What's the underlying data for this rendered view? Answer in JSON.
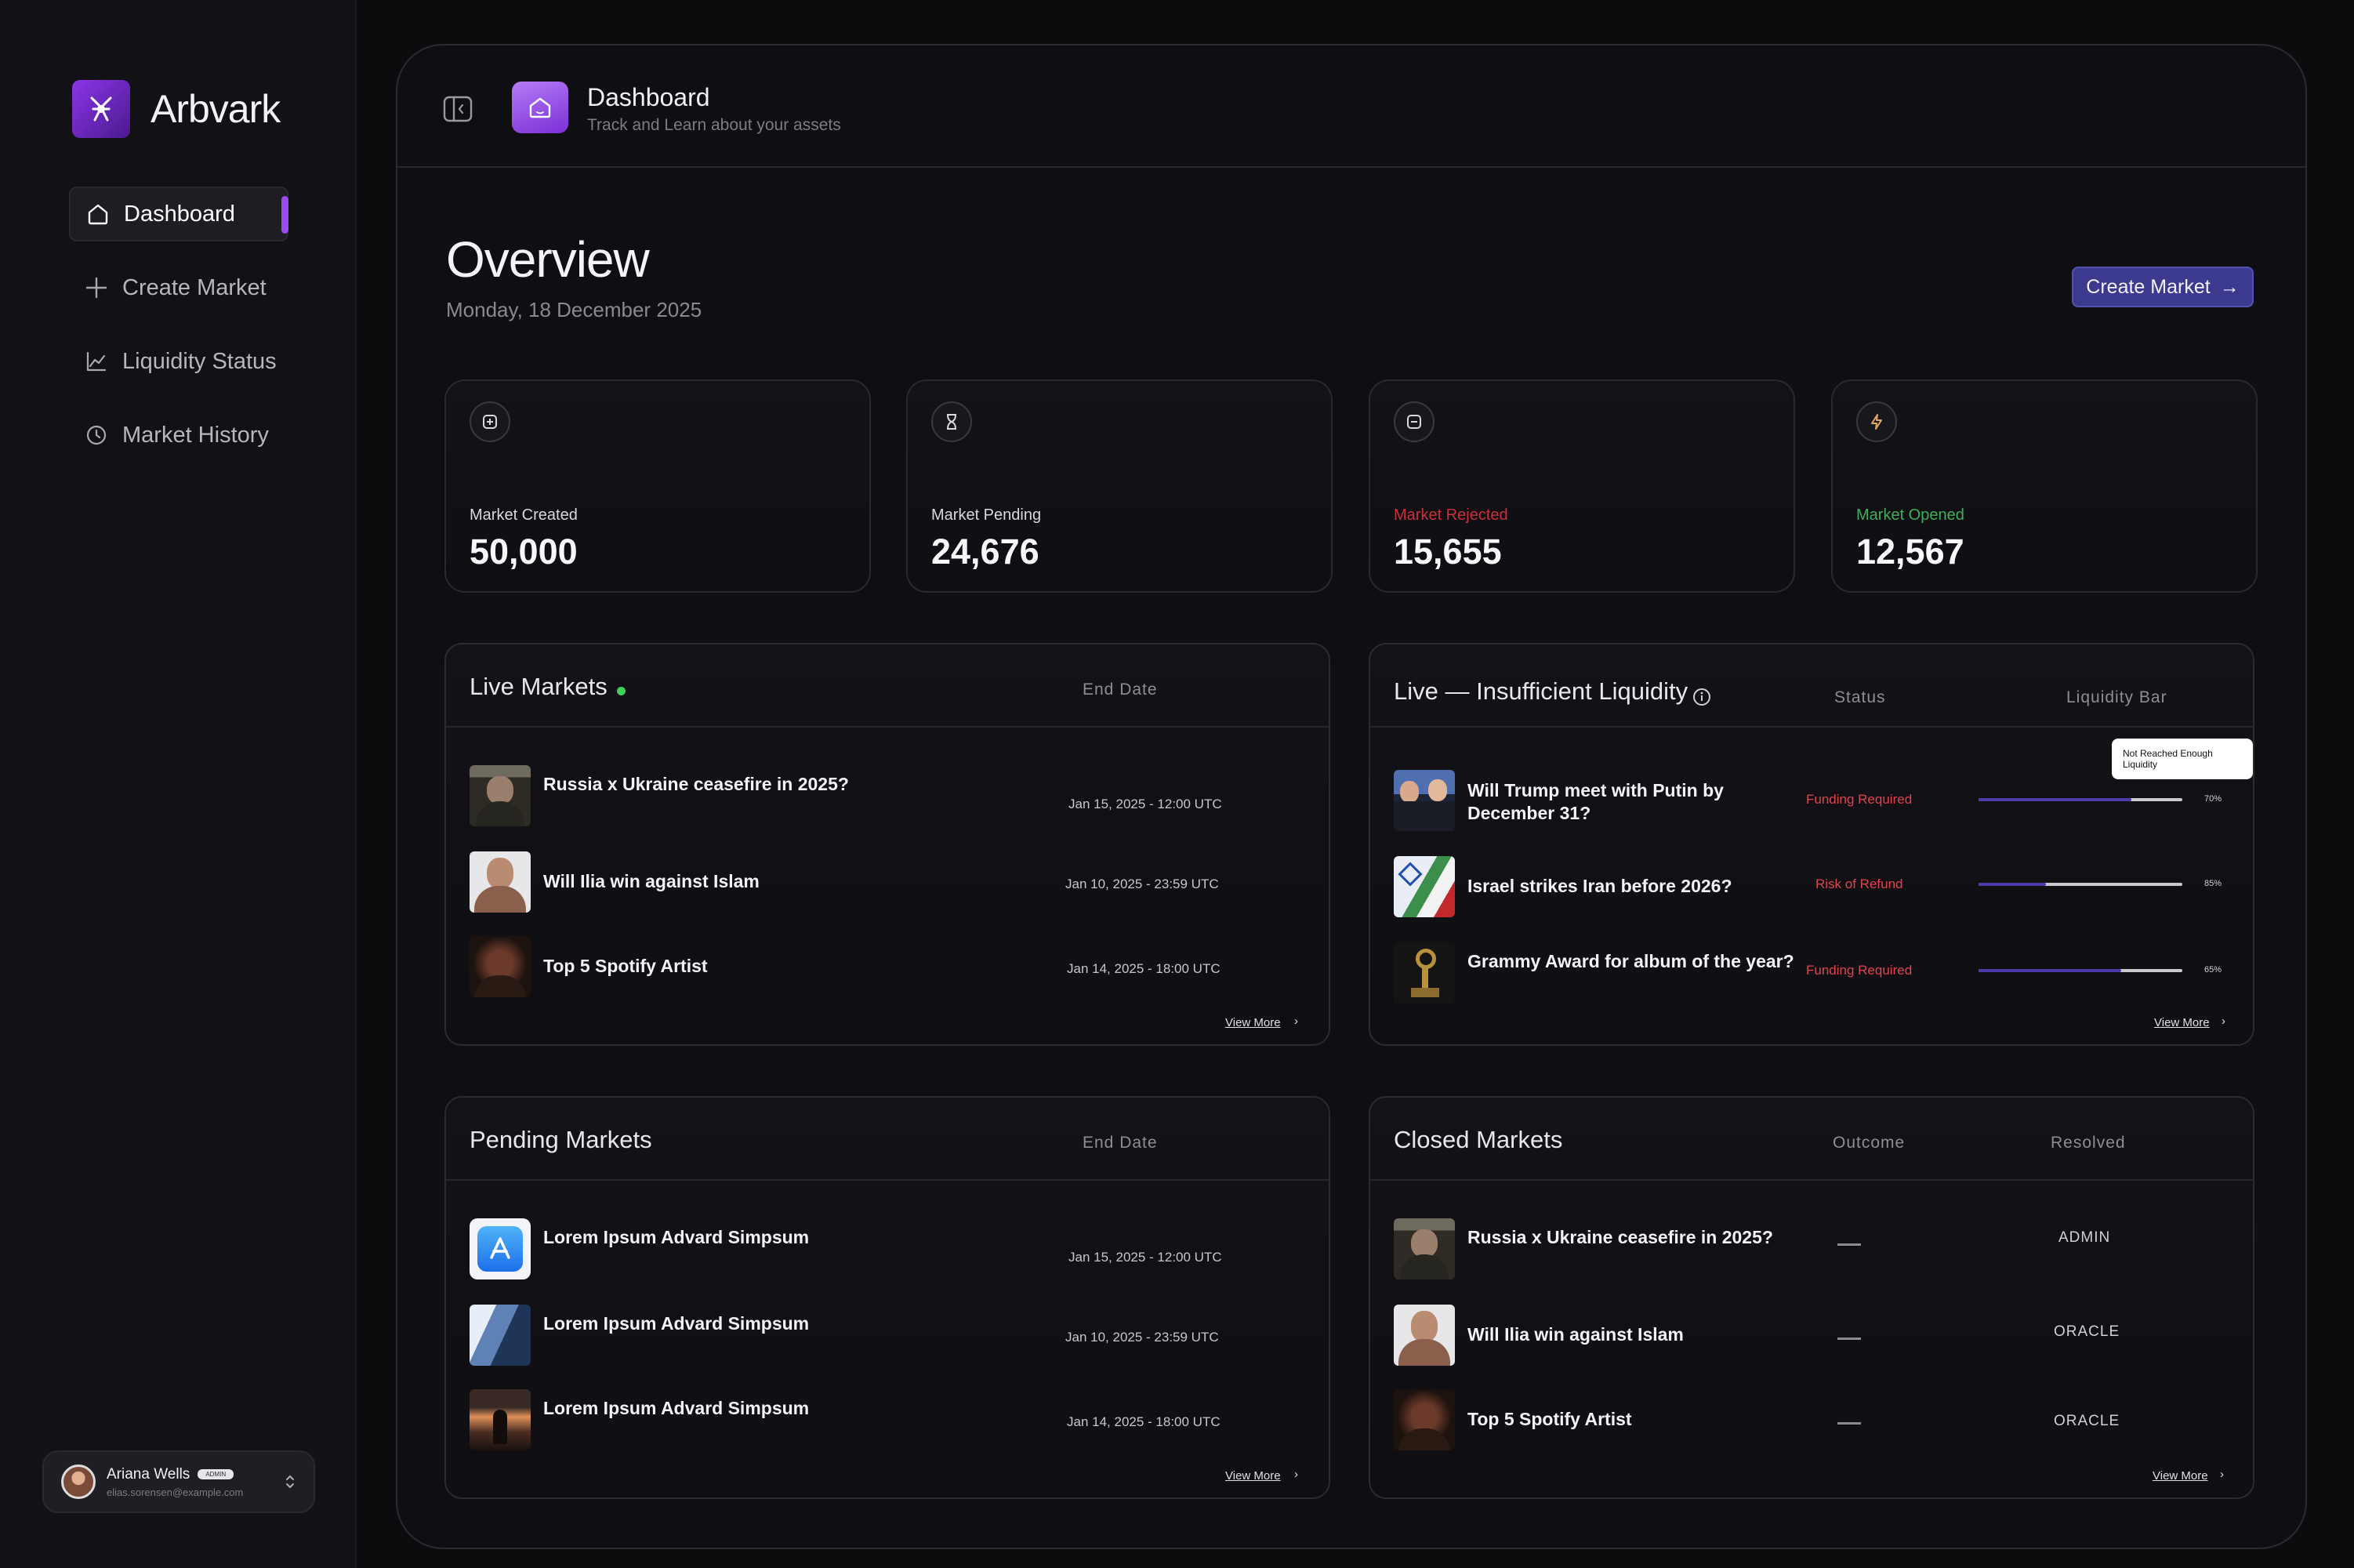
{
  "brand": {
    "name": "Arbvark"
  },
  "nav": [
    {
      "label": "Dashboard",
      "icon": "home-icon",
      "active": true
    },
    {
      "label": "Create Market",
      "icon": "plus-icon"
    },
    {
      "label": "Liquidity Status",
      "icon": "chart-line-icon"
    },
    {
      "label": "Market History",
      "icon": "clock-icon"
    }
  ],
  "user": {
    "name": "Ariana Wells",
    "badge": "ADMIN",
    "email": "elias.sorensen@example.com"
  },
  "topbar": {
    "title": "Dashboard",
    "subtitle": "Track and Learn about your assets"
  },
  "overview": {
    "title": "Overview",
    "date": "Monday, 18 December 2025",
    "create_button": "Create Market",
    "create_arrow": "→"
  },
  "stats": [
    {
      "label": "Market Created",
      "value": "50,000",
      "label_color": "#d8d8de",
      "icon": "plus-square-icon"
    },
    {
      "label": "Market Pending",
      "value": "24,676",
      "label_color": "#d8d8de",
      "icon": "hourglass-icon"
    },
    {
      "label": "Market Rejected",
      "value": "15,655",
      "label_color": "#c9303c",
      "icon": "minus-square-icon"
    },
    {
      "label": "Market Opened",
      "value": "12,567",
      "label_color": "#3fae5a",
      "icon": "lightning-icon"
    }
  ],
  "live_markets": {
    "title": "Live Markets",
    "col_end_date": "End Date",
    "view_more": "View More",
    "rows": [
      {
        "title": "Russia x Ukraine ceasefire in 2025?",
        "date": "Jan 15, 2025 - 12:00 UTC"
      },
      {
        "title": "Will Ilia win against Islam",
        "date": "Jan 10, 2025 - 23:59 UTC"
      },
      {
        "title": "Top 5 Spotify Artist",
        "date": "Jan 14, 2025 - 18:00 UTC"
      }
    ]
  },
  "insufficient": {
    "title": "Live — Insufficient Liquidity",
    "col_status": "Status",
    "col_bar": "Liquidity Bar",
    "tooltip": "Not Reached Enough Liquidity",
    "view_more": "View More",
    "rows": [
      {
        "title": "Will Trump meet with Putin by December 31?",
        "status": "Funding Required",
        "pct_label": "70%",
        "pct": 0.75
      },
      {
        "title": "Israel strikes Iran before 2026?",
        "status": "Risk of Refund",
        "pct_label": "85%",
        "pct": 0.33
      },
      {
        "title": "Grammy Award for album of the year?",
        "status": "Funding Required",
        "pct_label": "65%",
        "pct": 0.7
      }
    ]
  },
  "pending": {
    "title": "Pending Markets",
    "col_end_date": "End Date",
    "view_more": "View More",
    "rows": [
      {
        "title": "Lorem Ipsum Advard Simpsum",
        "date": "Jan 15, 2025 - 12:00 UTC"
      },
      {
        "title": "Lorem Ipsum Advard Simpsum",
        "date": "Jan 10, 2025 - 23:59 UTC"
      },
      {
        "title": "Lorem Ipsum Advard Simpsum",
        "date": "Jan 14, 2025 - 18:00 UTC"
      }
    ]
  },
  "closed": {
    "title": "Closed Markets",
    "col_outcome": "Outcome",
    "col_resolved": "Resolved",
    "view_more": "View More",
    "rows": [
      {
        "title": "Russia x Ukraine ceasefire in 2025?",
        "resolved": "ADMIN"
      },
      {
        "title": "Will Ilia win against Islam",
        "resolved": "ORACLE"
      },
      {
        "title": "Top 5 Spotify Artist",
        "resolved": "ORACLE"
      }
    ]
  },
  "colors": {
    "accent": "#9b4cf0",
    "button": "#3c3a8e",
    "danger": "#e0434e",
    "success": "#3fae5a",
    "bar_fill": "#4b3aa8"
  }
}
